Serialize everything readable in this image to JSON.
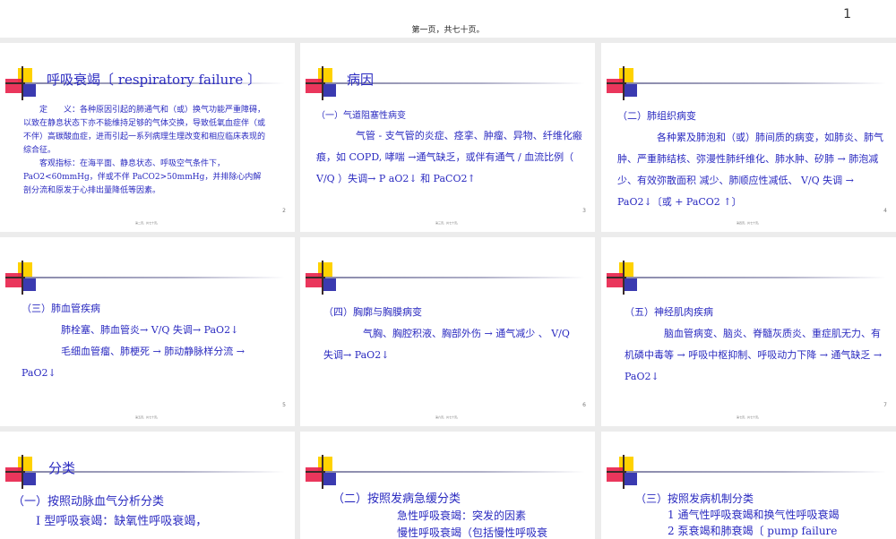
{
  "header": {
    "page_number": "1",
    "caption": "第一页，共七十页。"
  },
  "slides": [
    {
      "title": "呼吸衰竭〔 respiratory failure 〕",
      "paragraphs": [
        "定　　义：各种原因引起的肺通气和（或）换气功能严重障碍，以致在静息状态下亦不能维持足够的气体交换，导致低氧血症伴（或不伴）高碳酸血症，进而引起一系列病理生理改变和相应临床表现的综合征。",
        "客观指标：在海平面、静息状态、呼吸空气条件下， PaO2<60mmHg，伴或不伴 PaCO2>50mmHg，并排除心内解剖分流和原发于心排出量降低等因素。"
      ],
      "footer": "第二页，共七十页。",
      "number": "2"
    },
    {
      "title": "病因",
      "paragraphs": [
        "（一）气道阻塞性病变",
        "气管 - 支气管的炎症、痉挛、肿瘤、异物、纤维化瘢痕，如 COPD, 哮喘 →通气缺乏，或伴有通气 / 血流比例（ V/Q ）失调→ P aO2↓ 和 PaCO2↑"
      ],
      "footer": "第三页，共七十页。",
      "number": "3"
    },
    {
      "title": "",
      "paragraphs": [
        "（二）肺组织病变",
        "各种累及肺泡和（或）肺间质的病变，如肺炎、肺气肿、严重肺结核、弥漫性肺纤维化、肺水肿、矽肺 → 肺泡减少、有效弥散面积 减少、肺顺应性减低、 V/Q 失调 → PaO2↓〔或 + PaCO2 ↑〕"
      ],
      "footer": "第四页，共七十页。",
      "number": "4"
    },
    {
      "title": "",
      "paragraphs": [
        "（三）肺血管疾病",
        "肺栓塞、肺血管炎→ V/Q 失调→ PaO2↓",
        "毛细血管瘤、肺梗死 → 肺动静脉样分流 → PaO2↓"
      ],
      "footer": "第五页，共七十页。",
      "number": "5"
    },
    {
      "title": "",
      "paragraphs": [
        "（四）胸廓与胸膜病变",
        "气胸、胸腔积液、胸部外伤 → 通气减少 、 V/Q 失调→ PaO2↓"
      ],
      "footer": "第六页，共七十页。",
      "number": "6"
    },
    {
      "title": "",
      "paragraphs": [
        "（五）神经肌肉疾病",
        "脑血管病变、脑炎、脊髓灰质炎、重症肌无力、有机磷中毒等 → 呼吸中枢抑制、呼吸动力下降 → 通气缺乏 → PaO2↓"
      ],
      "footer": "第七页，共七十页。",
      "number": "7"
    },
    {
      "title": "分类",
      "paragraphs": [
        "（一）按照动脉血气分析分类",
        "I 型呼吸衰竭：缺氧性呼吸衰竭，"
      ]
    },
    {
      "title": "",
      "paragraphs": [
        "（二）按照发病急缓分类",
        "急性呼吸衰竭：突发的因素",
        "慢性呼吸衰竭（包括慢性呼吸衰"
      ]
    },
    {
      "title": "",
      "paragraphs": [
        "（三）按照发病机制分类",
        "1 通气性呼吸衰竭和换气性呼吸衰竭",
        "2 泵衰竭和肺衰竭〔 pump failure"
      ]
    }
  ]
}
